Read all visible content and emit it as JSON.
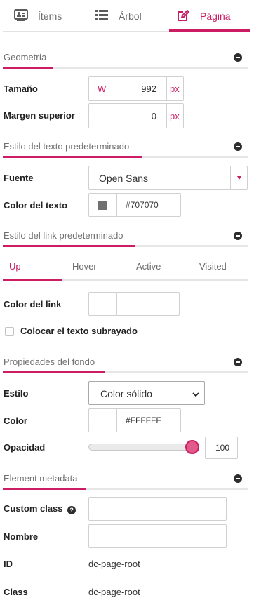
{
  "tabs": [
    {
      "label": "Ítems",
      "icon": "id-card-icon"
    },
    {
      "label": "Árbol",
      "icon": "list-icon"
    },
    {
      "label": "Página",
      "icon": "edit-icon"
    }
  ],
  "geometry": {
    "title": "Geometría",
    "size_label": "Tamaño",
    "size_unit_prefix": "W",
    "size_value": "992",
    "size_unit": "px",
    "margin_label": "Margen superior",
    "margin_value": "0",
    "margin_unit": "px"
  },
  "text_style": {
    "title": "Estilo del texto predeterminado",
    "font_label": "Fuente",
    "font_value": "Open Sans",
    "color_label": "Color del texto",
    "color_value": "#707070",
    "swatch_color": "#707070"
  },
  "link_style": {
    "title": "Estilo del link predeterminado",
    "states": [
      "Up",
      "Hover",
      "Active",
      "Visited"
    ],
    "color_label": "Color del link",
    "color_value": "",
    "underline_label": "Colocar el texto subrayado"
  },
  "background": {
    "title": "Propiedades del fondo",
    "style_label": "Estilo",
    "style_value": "Color sólido",
    "color_label": "Color",
    "color_value": "#FFFFFF",
    "opacity_label": "Opacidad",
    "opacity_value": "100",
    "opacity_fraction": 1.0
  },
  "metadata": {
    "title": "Element metadata",
    "custom_class_label": "Custom class",
    "custom_class_value": "",
    "name_label": "Nombre",
    "name_value": "",
    "id_label": "ID",
    "id_value": "dc-page-root",
    "class_label": "Class",
    "class_value": "dc-page-root"
  },
  "accent": "#cc1c63"
}
